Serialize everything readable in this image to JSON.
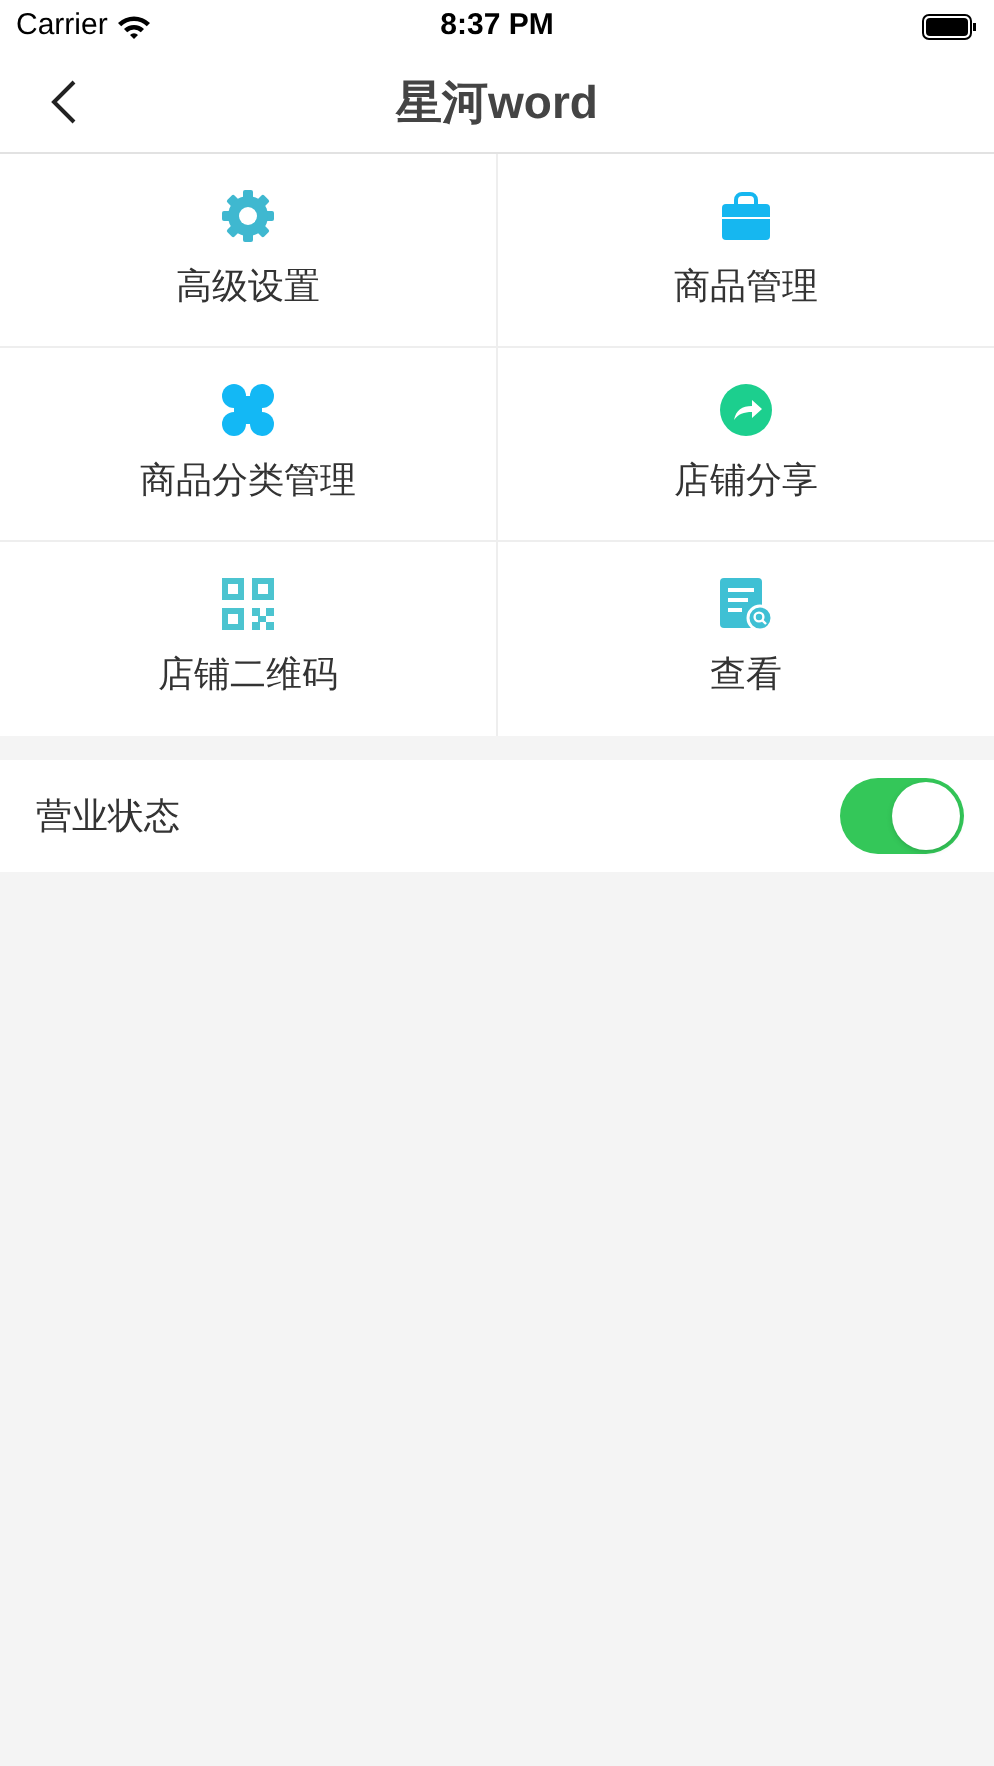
{
  "status_bar": {
    "carrier": "Carrier",
    "time": "8:37 PM"
  },
  "nav": {
    "title": "星河word"
  },
  "grid": [
    {
      "kind": "gear",
      "label": "高级设置"
    },
    {
      "kind": "bag",
      "label": "商品管理"
    },
    {
      "kind": "clover",
      "label": "商品分类管理"
    },
    {
      "kind": "share",
      "label": "店铺分享"
    },
    {
      "kind": "qr",
      "label": "店铺二维码"
    },
    {
      "kind": "doc",
      "label": "查看"
    }
  ],
  "business_status": {
    "label": "营业状态",
    "on": true
  }
}
